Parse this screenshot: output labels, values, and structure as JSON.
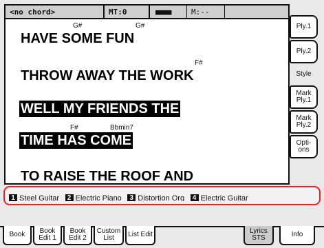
{
  "status": {
    "chord": "<no chord>",
    "meter": "MT:0",
    "bars": "■■■■",
    "measure": "M:--"
  },
  "lyrics": [
    {
      "chord1": "G#",
      "chord2": "G#",
      "text": "HAVE SOME FUN",
      "highlight": false
    },
    {
      "chord1": "F#",
      "chord2": "",
      "text": "THROW AWAY THE WORK",
      "highlight": false
    },
    {
      "chord1": "",
      "chord2": "",
      "text": "WELL MY FRIENDS THE",
      "highlight": true
    },
    {
      "chord1": "F#",
      "chord2": "Bbmin7",
      "text": "TIME HAS COME",
      "highlight": true
    },
    {
      "chord1": "",
      "chord2": "",
      "text": "TO RAISE THE ROOF AND",
      "highlight": false
    }
  ],
  "side_buttons": [
    "Ply.1",
    "Ply.2",
    "Style",
    "Mark Ply.1",
    "Mark Ply.2",
    "Opti- ons"
  ],
  "tracks": [
    {
      "num": "1",
      "name": "Steel Guitar"
    },
    {
      "num": "2",
      "name": "Electric Piano"
    },
    {
      "num": "3",
      "name": "Distortion Org"
    },
    {
      "num": "4",
      "name": "Electric Guitar"
    }
  ],
  "tabs": [
    "Book",
    "Book Edit 1",
    "Book Edit 2",
    "Custom List",
    "List Edit",
    "Lyrics STS",
    "Info"
  ]
}
